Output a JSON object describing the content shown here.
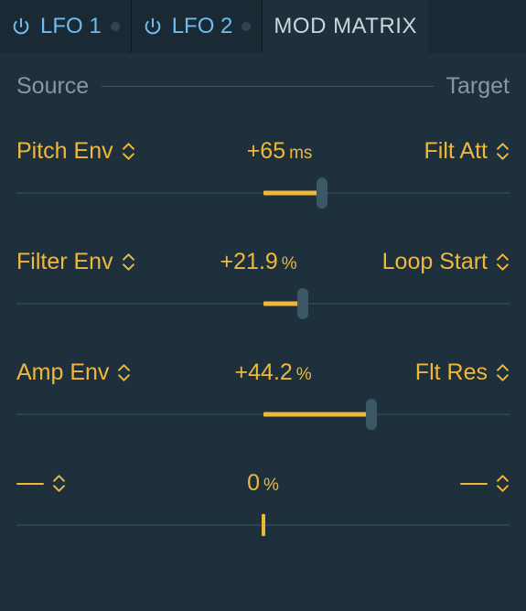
{
  "tabs": {
    "lfo1": "LFO 1",
    "lfo2": "LFO 2",
    "modmatrix": "MOD MATRIX"
  },
  "header": {
    "source": "Source",
    "target": "Target"
  },
  "rows": [
    {
      "source": "Pitch Env",
      "value": "+65",
      "unit": "ms",
      "target": "Filt Att",
      "center": 50,
      "thumb": 62,
      "empty": false,
      "showThumb": true
    },
    {
      "source": "Filter Env",
      "value": "+21.9",
      "unit": "%",
      "target": "Loop Start",
      "center": 50,
      "thumb": 58,
      "empty": false,
      "showThumb": true
    },
    {
      "source": "Amp Env",
      "value": "+44.2",
      "unit": "%",
      "target": "Flt Res",
      "center": 50,
      "thumb": 72,
      "empty": false,
      "showThumb": true
    },
    {
      "source": "",
      "value": "0",
      "unit": "%",
      "target": "",
      "center": 50,
      "thumb": 50,
      "empty": true,
      "showThumb": false
    }
  ]
}
